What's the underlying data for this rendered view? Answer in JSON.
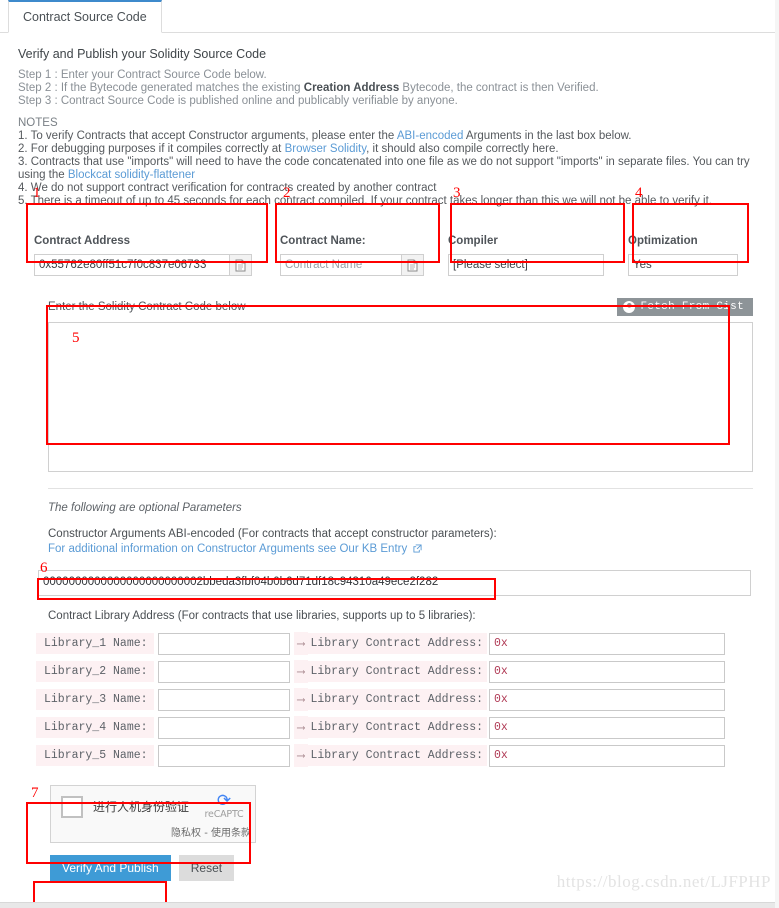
{
  "tab": {
    "label": "Contract Source Code"
  },
  "page": {
    "title": "Verify and Publish your Solidity Source Code",
    "steps": [
      {
        "prefix": "Step 1 : ",
        "text": "Enter your Contract Source Code below."
      },
      {
        "prefix": "Step 2 : ",
        "text_before": "If the Bytecode generated matches the existing ",
        "bold": "Creation Address",
        "text_after": " Bytecode, the contract is then Verified."
      },
      {
        "prefix": "Step 3 : ",
        "text": "Contract Source Code is published online and publicably verifiable by anyone."
      }
    ],
    "notes_heading": "NOTES",
    "notes": [
      {
        "n": "1. ",
        "pre": "To verify Contracts that accept Constructor arguments, please enter the ",
        "link": "ABI-encoded",
        "post": " Arguments in the last box below."
      },
      {
        "n": "2. ",
        "pre": "For debugging purposes if it compiles correctly at ",
        "link": "Browser Solidity",
        "post": ", it should also compile correctly here."
      },
      {
        "n": "3. ",
        "pre": "Contracts that use \"imports\" will need to have the code concatenated into one file as we do not support \"imports\" in separate files. You can try using the ",
        "link": "Blockcat solidity-flattener",
        "post": ""
      },
      {
        "n": "4. ",
        "pre": "We do not support contract verification for contracts created by another contract",
        "link": "",
        "post": ""
      },
      {
        "n": "5. ",
        "pre": "There is a timeout of up to 45 seconds for each contract compiled. If your contract takes longer than this we will not be able to verify it.",
        "link": "",
        "post": ""
      }
    ]
  },
  "markers": {
    "m1": "1",
    "m2": "2",
    "m3": "3",
    "m4": "4",
    "m5": "5",
    "m6": "6",
    "m7": "7"
  },
  "fields": {
    "contract_address": {
      "label": "Contract Address",
      "value": "0x55762e80ff51c7f0c837e06733",
      "addon_icon": "document-icon"
    },
    "contract_name": {
      "label": "Contract Name:",
      "value": "",
      "placeholder": "Contract Name",
      "addon_icon": "document-icon"
    },
    "compiler": {
      "label": "Compiler",
      "value": "[Please select]"
    },
    "optimization": {
      "label": "Optimization",
      "value": "Yes"
    }
  },
  "code_section": {
    "label": "Enter the Solidity Contract Code below",
    "gist_button": "Fetch From Gist",
    "gist_icon": "github-icon",
    "textarea_value": "",
    "textarea_placeholder": ""
  },
  "optional": {
    "note": "The following are optional Parameters",
    "ctor_label": "Constructor Arguments ABI-encoded (For contracts that accept constructor parameters):",
    "ctor_link": "For additional information on Constructor Arguments see Our KB Entry",
    "ctor_link_icon": "external-link-icon",
    "ctor_value": "0000000000000000000000002bbeda3fbf04b0b6d71df18c94310a49ece2f282"
  },
  "libraries": {
    "heading": "Contract Library Address (For contracts that use libraries, supports up to 5 libraries):",
    "arrow_icon": "arrow-right-icon",
    "address_label": "Library Contract Address:",
    "rows": [
      {
        "name_label": "Library_1 Name:",
        "name_value": "",
        "addr_value": "0x"
      },
      {
        "name_label": "Library_2 Name:",
        "name_value": "",
        "addr_value": "0x"
      },
      {
        "name_label": "Library_3 Name:",
        "name_value": "",
        "addr_value": "0x"
      },
      {
        "name_label": "Library_4 Name:",
        "name_value": "",
        "addr_value": "0x"
      },
      {
        "name_label": "Library_5 Name:",
        "name_value": "",
        "addr_value": "0x"
      }
    ]
  },
  "recaptcha": {
    "checkbox_label": "进行人机身份验证",
    "brand": "reCAPTC",
    "terms": "隐私权 - 使用条款",
    "logo_icon": "recaptcha-icon",
    "brand_color": "#4285f4"
  },
  "buttons": {
    "submit": "Verify And Publish",
    "reset": "Reset",
    "submit_color": "#3e9bd6"
  },
  "watermark": "https://blog.csdn.net/LJFPHP"
}
